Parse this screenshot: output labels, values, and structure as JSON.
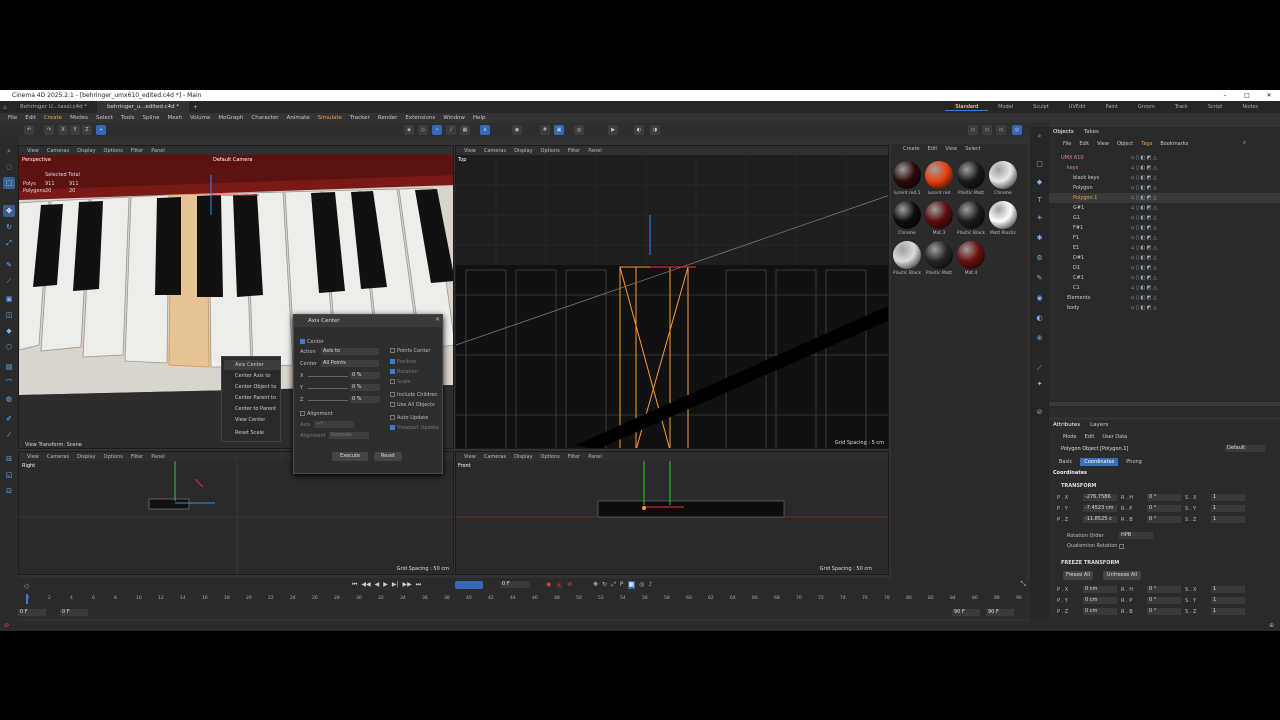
{
  "window": {
    "title": "Cinema 4D 2025.2.1 - [behringer_umx610_edited.c4d *] - Main"
  },
  "doc_tabs": [
    "Behringer U...tassi.c4d *",
    "behringer_u...edited.c4d *"
  ],
  "layouts": [
    "Standard",
    "Model",
    "Sculpt",
    "UVEdit",
    "Paint",
    "Groom",
    "Track",
    "Script",
    "Nodes"
  ],
  "menu": [
    "File",
    "Edit",
    "Create",
    "Modes",
    "Select",
    "Tools",
    "Spline",
    "Mesh",
    "Volume",
    "MoGraph",
    "Character",
    "Animate",
    "Simulate",
    "Tracker",
    "Render",
    "Extensions",
    "Window",
    "Help"
  ],
  "toolbar_axes": [
    "X",
    "Y",
    "Z"
  ],
  "viewport_menu": [
    "View",
    "Cameras",
    "Display",
    "Options",
    "Filter",
    "Panel"
  ],
  "viewports": {
    "perspective": {
      "label": "Perspective",
      "camera": "Default Camera",
      "stats_title": "Selected Total",
      "polys_label": "Polys",
      "polys_sel": "911",
      "polys_total": "911",
      "polygons_label": "Polygons",
      "polygons_sel": "20",
      "polygons_total": "20",
      "mode": "View Transform: Scene"
    },
    "top": {
      "label": "Top",
      "grid": "Grid Spacing : 5 cm"
    },
    "right": {
      "label": "Right",
      "grid": "Grid Spacing : 50 cm"
    },
    "front": {
      "label": "Front",
      "grid": "Grid Spacing : 50 cm"
    }
  },
  "context_menu": [
    "Axis Center",
    "Center Axis to",
    "Center Object to",
    "Center Parent to",
    "Center to Parent",
    "View Center",
    "Reset Scale"
  ],
  "axis_dialog": {
    "title": "Axis Center",
    "center_label": "Center",
    "action_label": "Action",
    "action_value": "Axis to",
    "center_field_label": "Center",
    "center_field_value": "All Points",
    "x_label": "X",
    "x_val": "0 %",
    "y_label": "Y",
    "y_val": "0 %",
    "z_label": "Z",
    "z_val": "0 %",
    "alignment_label": "Alignment",
    "axis_label": "Axis",
    "axis_value": "+Y",
    "alignment2_label": "Alignment",
    "alignment2_value": "Normals",
    "points_center": "Points Center",
    "position": "Position",
    "rotation": "Rotation",
    "scale": "Scale",
    "include_children": "Include Children",
    "use_all_objects": "Use All Objects",
    "auto_update": "Auto Update",
    "viewport_update": "Viewport Update",
    "execute": "Execute",
    "reset": "Reset"
  },
  "material_menu": [
    "Create",
    "Edit",
    "View",
    "Select"
  ],
  "materials": [
    {
      "name": "lucent red.1",
      "color": "#2a0a08"
    },
    {
      "name": "lucent red",
      "color": "#e8400e"
    },
    {
      "name": "Plastic Matt",
      "color": "#1a1a1a"
    },
    {
      "name": "Chrome",
      "color": "#e8e8e8"
    },
    {
      "name": "Chrome",
      "color": "#0e0e0e"
    },
    {
      "name": "Mat.3",
      "color": "#5a0f0e"
    },
    {
      "name": "Plastic Black",
      "color": "#1c1c1c"
    },
    {
      "name": "Matt Plastic",
      "color": "#ffffff"
    },
    {
      "name": "Plastic Black",
      "color": "#dcdcdc"
    },
    {
      "name": "Plastic Matt",
      "color": "#262626"
    },
    {
      "name": "Mat.4",
      "color": "#6a1010"
    }
  ],
  "objects_panel": {
    "tabs": [
      "Objects",
      "Takes"
    ],
    "menu": [
      "File",
      "Edit",
      "View",
      "Object",
      "Tags",
      "Bookmarks"
    ],
    "items": [
      "UMX 610",
      "keys",
      "black keys",
      "Polygon",
      "Polygon.1",
      "G#1",
      "G1",
      "F#1",
      "F1",
      "E1",
      "D#1",
      "D1",
      "C#1",
      "C1",
      "Elements",
      "body"
    ]
  },
  "attributes_panel": {
    "tabs": [
      "Attributes",
      "Layers"
    ],
    "menu": [
      "Mode",
      "Edit",
      "User Data"
    ],
    "object": "Polygon Object [Polygon.1]",
    "preset": "Default",
    "subtabs": [
      "Basic",
      "Coordinates",
      "Phong"
    ],
    "section_title": "Coordinates",
    "transform": "TRANSFORM",
    "pos": [
      {
        "axis": "P . X",
        "val": "-276.7586"
      },
      {
        "axis": "P . Y",
        "val": "-7.4523 cm"
      },
      {
        "axis": "P . Z",
        "val": "-11.8525 c"
      }
    ],
    "rot": [
      {
        "axis": "R . H",
        "val": "0 °"
      },
      {
        "axis": "R . P",
        "val": "0 °"
      },
      {
        "axis": "R . B",
        "val": "0 °"
      }
    ],
    "scale": [
      {
        "axis": "S . X",
        "val": "1"
      },
      {
        "axis": "S . Y",
        "val": "1"
      },
      {
        "axis": "S . Z",
        "val": "1"
      }
    ],
    "rotation_order_label": "Rotation Order",
    "rotation_order": "HPB",
    "quaternion_label": "Quaternion Rotation",
    "freeze_title": "FREEZE TRANSFORM",
    "freeze_all": "Freeze All",
    "unfreeze_all": "Unfreeze All",
    "fpos": [
      {
        "axis": "P . X",
        "val": "0 cm"
      },
      {
        "axis": "P . Y",
        "val": "0 cm"
      },
      {
        "axis": "P . Z",
        "val": "0 cm"
      }
    ],
    "frot": [
      {
        "axis": "R . H",
        "val": "0 °"
      },
      {
        "axis": "R . P",
        "val": "0 °"
      },
      {
        "axis": "R . B",
        "val": "0 °"
      }
    ],
    "fscale": [
      {
        "axis": "S . X",
        "val": "1"
      },
      {
        "axis": "S . Y",
        "val": "1"
      },
      {
        "axis": "S . Z",
        "val": "1"
      }
    ]
  },
  "timeline": {
    "current_frame": "0 F",
    "start": "0 F",
    "start2": "0 F",
    "end": "90 F",
    "end2": "90 F",
    "ticks": [
      "0",
      "2",
      "4",
      "6",
      "8",
      "10",
      "12",
      "14",
      "16",
      "18",
      "20",
      "22",
      "24",
      "26",
      "28",
      "30",
      "32",
      "34",
      "36",
      "38",
      "40",
      "42",
      "44",
      "46",
      "48",
      "50",
      "52",
      "54",
      "56",
      "58",
      "60",
      "62",
      "64",
      "66",
      "68",
      "70",
      "72",
      "74",
      "76",
      "78",
      "80",
      "82",
      "84",
      "86",
      "88",
      "90"
    ]
  }
}
